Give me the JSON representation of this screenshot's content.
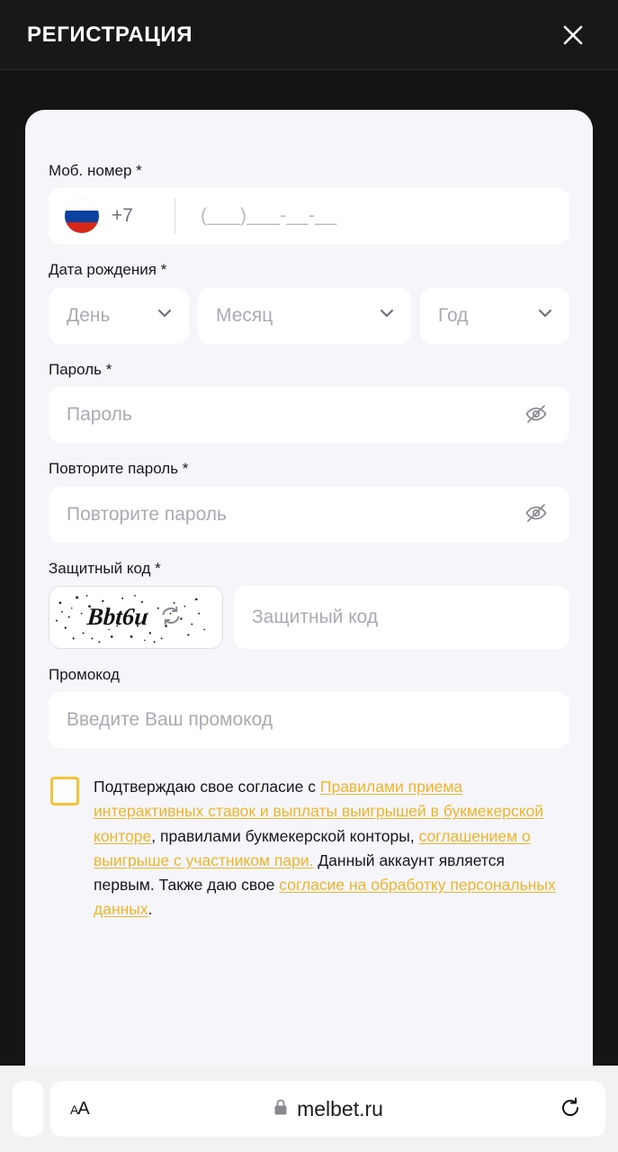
{
  "header": {
    "title": "РЕГИСТРАЦИЯ",
    "close_icon": "close-icon"
  },
  "form": {
    "phone": {
      "label": "Моб. номер *",
      "country_code": "+7",
      "flag": "russia-flag-icon",
      "mask_placeholder": "(___)___-__-__"
    },
    "birthdate": {
      "label": "Дата рождения *",
      "day_placeholder": "День",
      "month_placeholder": "Месяц",
      "year_placeholder": "Год"
    },
    "password": {
      "label": "Пароль *",
      "placeholder": "Пароль",
      "toggle_icon": "eye-off-icon"
    },
    "repeat_password": {
      "label": "Повторите пароль *",
      "placeholder": "Повторите пароль",
      "toggle_icon": "eye-off-icon"
    },
    "captcha": {
      "label": "Защитный код *",
      "image_text": "Bbt6u",
      "refresh_icon": "refresh-icon",
      "placeholder": "Защитный код"
    },
    "promo": {
      "label": "Промокод",
      "placeholder": "Введите Ваш промокод"
    },
    "consent": {
      "checked": false,
      "text_1": "Подтверждаю свое согласие с ",
      "link_1": "Правилами приема интерактивных ставок и выплаты выигрышей в букмекерской конторе",
      "text_2": ", правилами букмекерской конторы, ",
      "link_2": "соглашением о выигрыше с участником пари.",
      "text_3": " Данный аккаунт является первым. Также даю свое ",
      "link_3": "согласие на обработку персональных данных",
      "text_4": "."
    }
  },
  "browser": {
    "text_size_label": "AA",
    "lock_icon": "lock-icon",
    "url": "melbet.ru",
    "reload_icon": "reload-icon"
  },
  "colors": {
    "accent": "#f0b429",
    "checkbox_border": "#f5c23a",
    "header_bg": "#181818",
    "card_bg": "#f6f6fa"
  }
}
